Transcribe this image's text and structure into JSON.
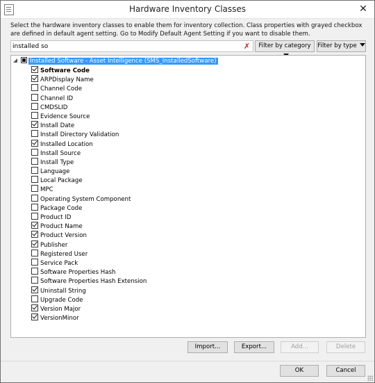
{
  "window": {
    "title": "Hardware Inventory Classes",
    "close_glyph": "✕"
  },
  "description": "Select the hardware inventory classes to enable them for inventory collection. Class properties with grayed checkbox are defined in default agent setting. Go to Modify Default Agent Setting if you want to disable them.",
  "search": {
    "value": "installed so",
    "clear_icon": "✗"
  },
  "filters": {
    "category_label": "Filter by category",
    "type_label": "Filter by type"
  },
  "tree": {
    "root_label": "Installed Software - Asset Intelligence (SMS_InstalledSoftware)",
    "items": [
      {
        "label": "Software Code",
        "checked": true,
        "bold": true
      },
      {
        "label": "ARPDisplay Name",
        "checked": true
      },
      {
        "label": "Channel Code",
        "checked": false
      },
      {
        "label": "Channel ID",
        "checked": false
      },
      {
        "label": "CMDSLID",
        "checked": false
      },
      {
        "label": "Evidence Source",
        "checked": false
      },
      {
        "label": "Install Date",
        "checked": true
      },
      {
        "label": "Install Directory Validation",
        "checked": false
      },
      {
        "label": "Installed Location",
        "checked": true
      },
      {
        "label": "Install Source",
        "checked": false
      },
      {
        "label": "Install Type",
        "checked": false
      },
      {
        "label": "Language",
        "checked": false
      },
      {
        "label": "Local Package",
        "checked": false
      },
      {
        "label": "MPC",
        "checked": false
      },
      {
        "label": "Operating System Component",
        "checked": false
      },
      {
        "label": "Package Code",
        "checked": false
      },
      {
        "label": "Product ID",
        "checked": false
      },
      {
        "label": "Product Name",
        "checked": true
      },
      {
        "label": "Product Version",
        "checked": true
      },
      {
        "label": "Publisher",
        "checked": true
      },
      {
        "label": "Registered User",
        "checked": false
      },
      {
        "label": "Service Pack",
        "checked": false
      },
      {
        "label": "Software Properties Hash",
        "checked": false
      },
      {
        "label": "Software Properties Hash Extension",
        "checked": false
      },
      {
        "label": "Uninstall String",
        "checked": true
      },
      {
        "label": "Upgrade Code",
        "checked": false
      },
      {
        "label": "Version Major",
        "checked": true
      },
      {
        "label": "VersionMinor",
        "checked": true
      }
    ]
  },
  "buttons": {
    "import": "Import...",
    "export": "Export...",
    "add": "Add...",
    "delete": "Delete",
    "ok": "OK",
    "cancel": "Cancel"
  }
}
